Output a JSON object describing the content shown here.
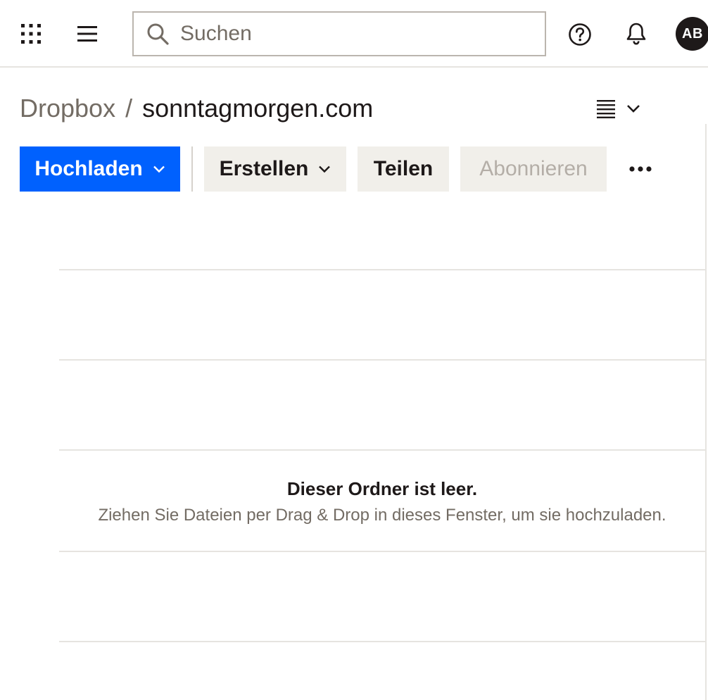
{
  "header": {
    "search": {
      "placeholder": "Suchen",
      "value": ""
    },
    "avatar_initials": "AB",
    "icons": [
      "apps-grid-icon",
      "hamburger-menu-icon",
      "search-icon",
      "help-icon",
      "bell-icon"
    ]
  },
  "breadcrumb": {
    "root": "Dropbox",
    "separator": "/",
    "current": "sonntagmorgen.com"
  },
  "view_toggle": {
    "icons": [
      "list-view-icon",
      "chevron-down-icon"
    ]
  },
  "toolbar": {
    "upload_label": "Hochladen",
    "create_label": "Erstellen",
    "share_label": "Teilen",
    "subscribe_label": "Abonnieren",
    "subscribe_disabled": true,
    "more_icon": "more-horizontal-icon"
  },
  "empty_state": {
    "title": "Dieser Ordner ist leer.",
    "subtitle": "Ziehen Sie Dateien per Drag & Drop in dieses Fenster, um sie hochzuladen."
  },
  "colors": {
    "primary": "#0061fe",
    "secondary_button": "#f1efea",
    "text": "#1e1919",
    "muted_text": "#736c64",
    "border": "#e6e4e0"
  }
}
